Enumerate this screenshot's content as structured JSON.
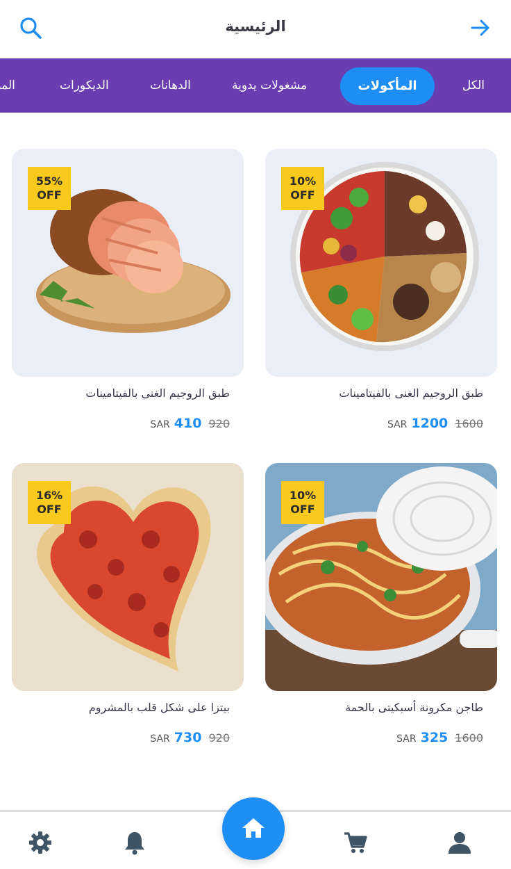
{
  "header": {
    "title": "الرئيسية",
    "search_icon": "search-icon",
    "back_icon": "arrow-right-icon"
  },
  "categories": [
    {
      "label": "الكل",
      "active": false
    },
    {
      "label": "المأكولات",
      "active": true
    },
    {
      "label": "مشغولات يدوية",
      "active": false
    },
    {
      "label": "الدهانات",
      "active": false
    },
    {
      "label": "الديكورات",
      "active": false
    },
    {
      "label": "الملا",
      "active": false
    }
  ],
  "products": [
    {
      "discount": "10%",
      "off": "OFF",
      "name": "طبق الروجيم الغنى بالفيتامينات",
      "currency": "SAR",
      "price": "1200",
      "old_price": "1600",
      "image": "healthy-plate"
    },
    {
      "discount": "55%",
      "off": "OFF",
      "name": "طبق الروجيم الغنى بالفيتامينات",
      "currency": "SAR",
      "price": "410",
      "old_price": "920",
      "image": "ham"
    },
    {
      "discount": "10%",
      "off": "OFF",
      "name": "طاجن مكرونة أسبكيتى بالحمة",
      "currency": "SAR",
      "price": "325",
      "old_price": "1600",
      "image": "spaghetti-pan"
    },
    {
      "discount": "16%",
      "off": "OFF",
      "name": "بيتزا على شكل قلب بالمشروم",
      "currency": "SAR",
      "price": "730",
      "old_price": "920",
      "image": "heart-pizza"
    }
  ],
  "bottom_nav": {
    "items": [
      "gear-icon",
      "bell-icon",
      "home-icon",
      "cart-icon",
      "user-icon"
    ]
  },
  "colors": {
    "primary": "#1e8ef5",
    "category_bar": "#6a3db0",
    "badge": "#f9c91d"
  }
}
